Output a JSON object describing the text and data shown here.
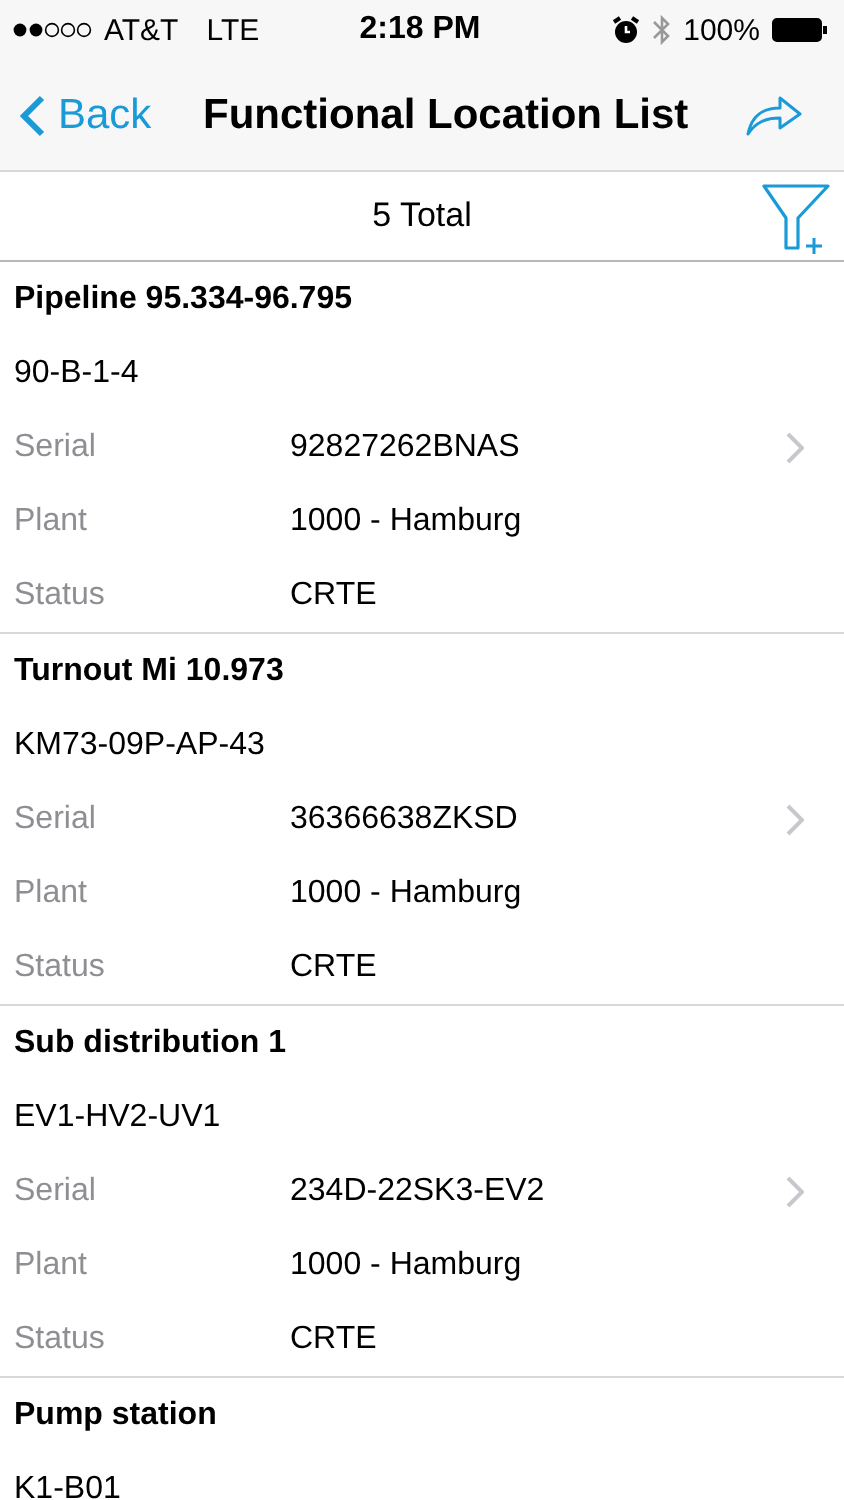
{
  "status_bar": {
    "carrier": "AT&T",
    "network": "LTE",
    "time": "2:18 PM",
    "battery": "100%"
  },
  "nav": {
    "back": "Back",
    "title": "Functional Location List"
  },
  "summary": {
    "total": "5 Total"
  },
  "items": [
    {
      "title": "Pipeline 95.334-96.795",
      "code": "90-B-1-4",
      "fields": [
        {
          "label": "Serial",
          "value": "92827262BNAS"
        },
        {
          "label": "Plant",
          "value": "1000 - Hamburg"
        },
        {
          "label": "Status",
          "value": "CRTE"
        }
      ]
    },
    {
      "title": "Turnout Mi 10.973",
      "code": "KM73-09P-AP-43",
      "fields": [
        {
          "label": "Serial",
          "value": "36366638ZKSD"
        },
        {
          "label": "Plant",
          "value": "1000 - Hamburg"
        },
        {
          "label": "Status",
          "value": "CRTE"
        }
      ]
    },
    {
      "title": "Sub distribution 1",
      "code": "EV1-HV2-UV1",
      "fields": [
        {
          "label": "Serial",
          "value": "234D-22SK3-EV2"
        },
        {
          "label": "Plant",
          "value": "1000 - Hamburg"
        },
        {
          "label": "Status",
          "value": "CRTE"
        }
      ]
    },
    {
      "title": "Pump station",
      "code": "K1-B01"
    }
  ]
}
